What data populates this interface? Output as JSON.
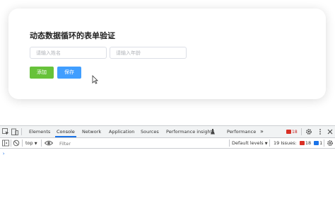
{
  "form": {
    "title": "动态数据循环的表单验证",
    "name_placeholder": "请输入姓名",
    "age_placeholder": "请输入年龄",
    "add_label": "添加",
    "save_label": "保存"
  },
  "devtools": {
    "tabs": [
      {
        "label": "Elements"
      },
      {
        "label": "Console"
      },
      {
        "label": "Network"
      },
      {
        "label": "Application"
      },
      {
        "label": "Sources"
      },
      {
        "label": "Performance insights"
      },
      {
        "label": "Performance"
      }
    ],
    "more_tabs": "»",
    "error_count": "18",
    "context": "top",
    "filter_placeholder": "Filter",
    "levels_label": "Default levels",
    "issues_label": "19 Issues:",
    "issues_errors": "18",
    "issues_info": "1",
    "console_prompt": "›"
  },
  "colors": {
    "add_button": "#67c23a",
    "save_button": "#409eff",
    "tab_active": "#1a73e8",
    "error": "#d93025"
  }
}
